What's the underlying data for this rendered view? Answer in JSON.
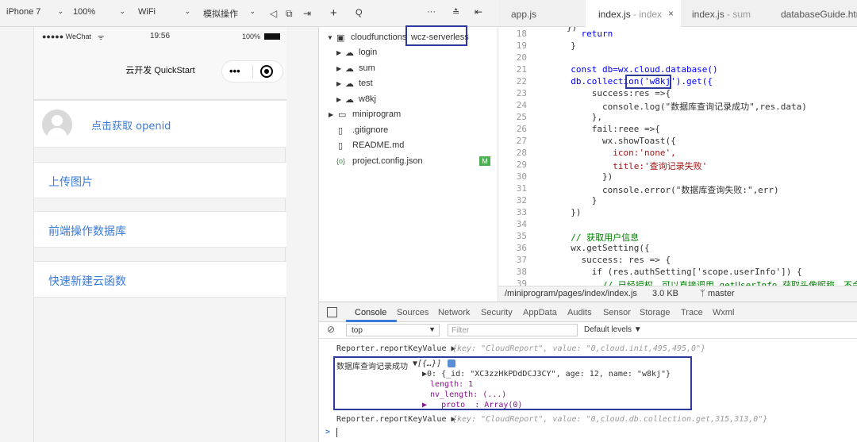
{
  "simulator": {
    "device": "iPhone 7",
    "zoom": "100%",
    "network": "WiFi",
    "mode": "模拟操作",
    "status_left": "●●●●● WeChat",
    "status_time": "19:56",
    "status_battery": "100%",
    "nav_title": "云开发 QuickStart",
    "capsule_more": "•••",
    "cards": [
      {
        "label": "点击获取 openid"
      },
      {
        "label": "上传图片"
      },
      {
        "label": "前端操作数据库"
      },
      {
        "label": "快速新建云函数"
      }
    ]
  },
  "explorer": {
    "toolbar": {
      "add": "+",
      "search": "Q",
      "more": "···"
    },
    "root_folder": "cloudfunctions",
    "env_label": "wcz-serverless",
    "cloud_functions": [
      "login",
      "sum",
      "test",
      "w8kj"
    ],
    "other_items": [
      {
        "name": "miniprogram",
        "type": "folder"
      },
      {
        "name": ".gitignore",
        "type": "file"
      },
      {
        "name": "README.md",
        "type": "file"
      },
      {
        "name": "project.config.json",
        "type": "json",
        "badge": "M"
      }
    ]
  },
  "editor": {
    "tabs": [
      {
        "label": "app.js",
        "suffix": "",
        "active": false
      },
      {
        "label": "index.js",
        "suffix": " - index",
        "active": true
      },
      {
        "label": "index.js",
        "suffix": " - sum",
        "active": false
      },
      {
        "label": "databaseGuide.htm",
        "suffix": "",
        "active": false
      }
    ],
    "lines": [
      {
        "no": "18",
        "text": "    return"
      },
      {
        "no": "19",
        "text": "  }"
      },
      {
        "no": "20",
        "text": ""
      },
      {
        "no": "21",
        "text": "  const db=wx.cloud.database()"
      },
      {
        "no": "22",
        "text": "  db.collection('w8kj').get({"
      },
      {
        "no": "23",
        "text": "      success:res =>{"
      },
      {
        "no": "24",
        "text": "        console.log(\"数据库查询记录成功\",res.data)"
      },
      {
        "no": "25",
        "text": "      },"
      },
      {
        "no": "26",
        "text": "      fail:reee =>{"
      },
      {
        "no": "27",
        "text": "        wx.showToast({"
      },
      {
        "no": "28",
        "text": "          icon:'none',"
      },
      {
        "no": "29",
        "text": "          title:'查询记录失败'"
      },
      {
        "no": "30",
        "text": "        })"
      },
      {
        "no": "31",
        "text": "        console.error(\"数据库查询失败:\",err)"
      },
      {
        "no": "32",
        "text": "      }"
      },
      {
        "no": "33",
        "text": "  })"
      },
      {
        "no": "34",
        "text": ""
      },
      {
        "no": "35",
        "text": "  // 获取用户信息"
      },
      {
        "no": "36",
        "text": "  wx.getSetting({"
      },
      {
        "no": "37",
        "text": "    success: res => {"
      },
      {
        "no": "38",
        "text": "      if (res.authSetting['scope.userInfo']) {"
      },
      {
        "no": "39",
        "text": "        // 已经授权，可以直接调用 getUserInfo 获取头像昵称，不会"
      }
    ],
    "status": {
      "path": "/miniprogram/pages/index/index.js",
      "size": "3.0 KB",
      "branch": "master"
    }
  },
  "devtools": {
    "tabs": [
      "Console",
      "Sources",
      "Network",
      "Security",
      "AppData",
      "Audits",
      "Sensor",
      "Storage",
      "Trace",
      "Wxml"
    ],
    "context": "top",
    "filter_placeholder": "Filter",
    "levels": "Default levels ▼",
    "log1_prefix": "Reporter.reportKeyValue ▶",
    "log1_body": "{key: \"CloudReport\", value: \"0,cloud.init,495,495,0\"}",
    "log2_label": "数据库查询记录成功",
    "log2_summary": "▼[{…}]",
    "log2_item": "▶0: {_id: \"XC3zzHkPDdDCJ3CY\", age: 12, name: \"w8kj\"}",
    "log2_length": "length: 1",
    "log2_nvlength": "nv_length: (...)",
    "log2_proto": "▶ __proto__: Array(0)",
    "log3_prefix": "Reporter.reportKeyValue ▶",
    "log3_body": "{key: \"CloudReport\", value: \"0,cloud.db.collection.get,315,313,0\"}",
    "prompt": ">"
  },
  "colors": {
    "link": "#3a7bd5",
    "highlight_box": "#2b3a9b",
    "keyword": "#0000ff",
    "string": "#a31515",
    "comment": "#008000"
  }
}
